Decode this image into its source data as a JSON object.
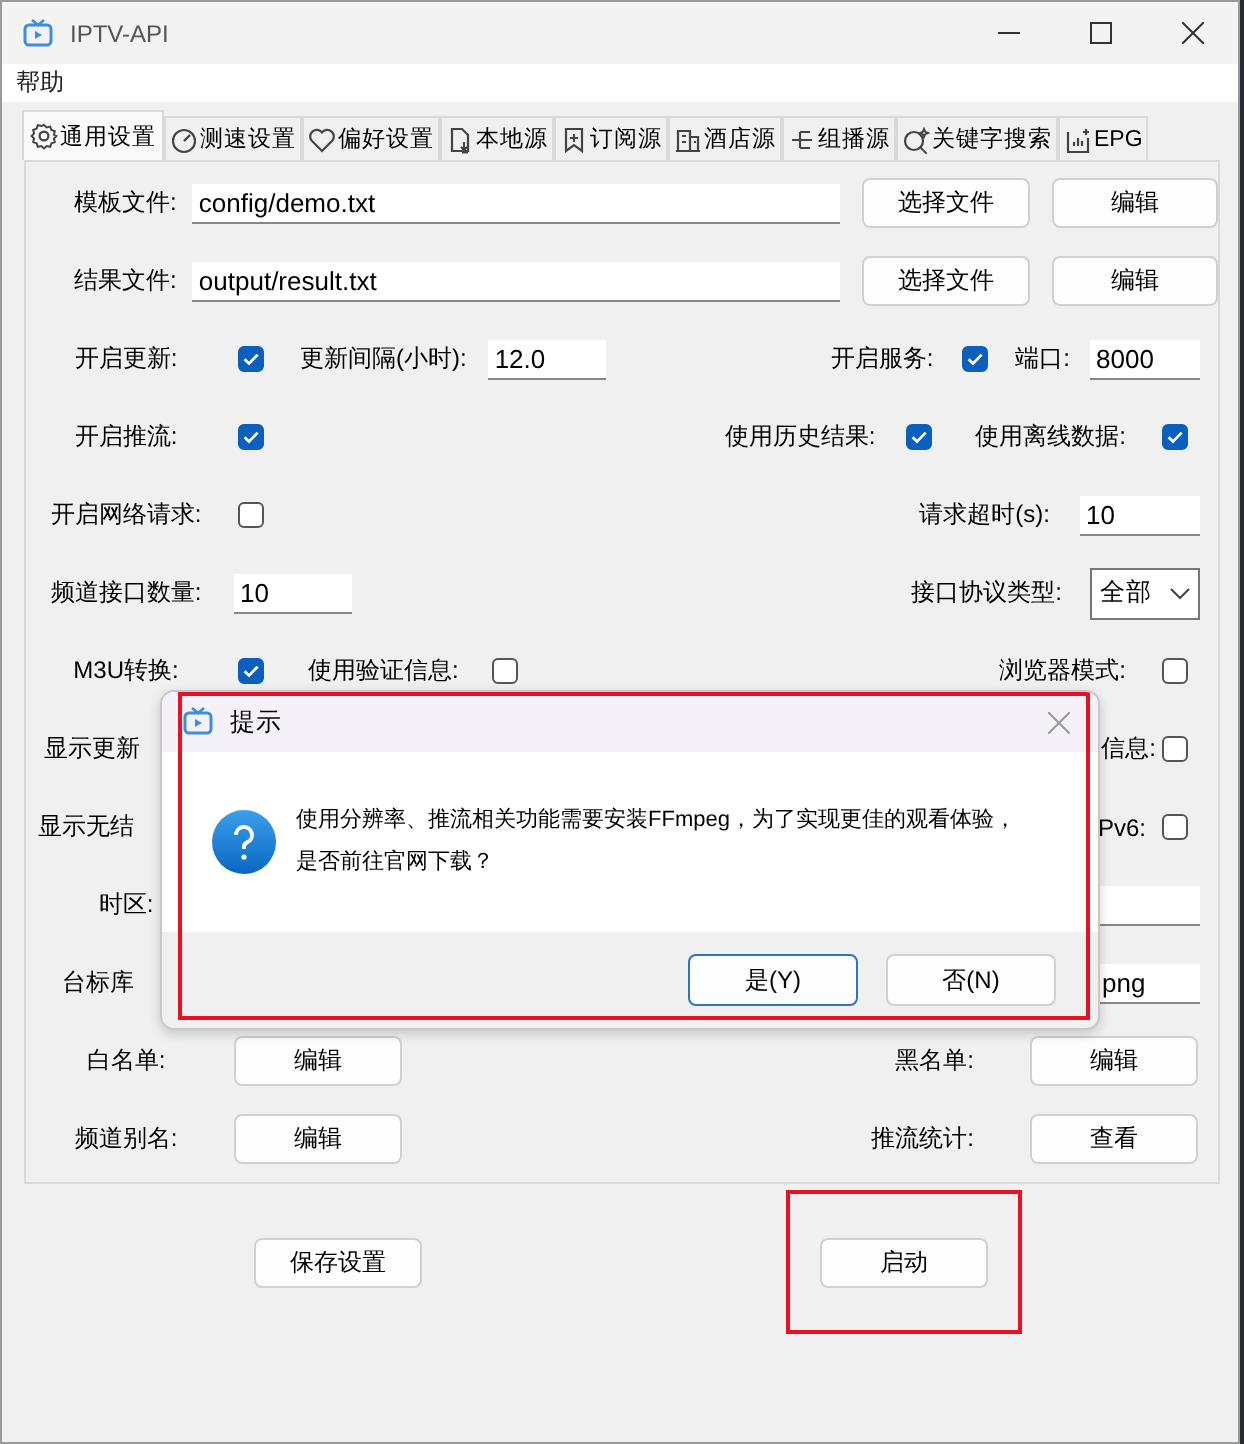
{
  "window": {
    "title": "IPTV-API"
  },
  "menu": [
    "帮助"
  ],
  "tabs": [
    {
      "label": "通用设置",
      "selected": true
    },
    {
      "label": "测速设置",
      "selected": false
    },
    {
      "label": "偏好设置",
      "selected": false
    },
    {
      "label": "本地源",
      "selected": false
    },
    {
      "label": "订阅源",
      "selected": false
    },
    {
      "label": "酒店源",
      "selected": false
    },
    {
      "label": "组播源",
      "selected": false
    },
    {
      "label": "关键字搜索",
      "selected": false
    },
    {
      "label": "EPG",
      "selected": false
    }
  ],
  "general": {
    "template_file": {
      "label": "模板文件:",
      "value": "config/demo.txt",
      "choose": "选择文件",
      "edit": "编辑"
    },
    "result_file": {
      "label": "结果文件:",
      "value": "output/result.txt",
      "choose": "选择文件",
      "edit": "编辑"
    },
    "open_update": {
      "label": "开启更新:",
      "checked": true
    },
    "update_interval": {
      "label": "更新间隔(小时):",
      "value": "12.0"
    },
    "open_service": {
      "label": "开启服务:",
      "checked": true
    },
    "port": {
      "label": "端口:",
      "value": "8000"
    },
    "open_rtmp": {
      "label": "开启推流:",
      "checked": true
    },
    "use_history": {
      "label": "使用历史结果:",
      "checked": true
    },
    "use_offline": {
      "label": "使用离线数据:",
      "checked": true
    },
    "open_request": {
      "label": "开启网络请求:",
      "checked": false
    },
    "request_timeout": {
      "label": "请求超时(s):",
      "value": "10"
    },
    "urls_limit": {
      "label": "频道接口数量:",
      "value": "10"
    },
    "ipv_type": {
      "label": "接口协议类型:",
      "value": "全部"
    },
    "m3u": {
      "label": "M3U转换:",
      "checked": true
    },
    "auth": {
      "label": "使用验证信息:",
      "checked": false
    },
    "browser": {
      "label": "浏览器模式:",
      "checked": false
    },
    "show_update_label": "显示更新",
    "info": {
      "label": "信息:",
      "checked": false
    },
    "show_noresult_label": "显示无结",
    "ipv6": {
      "label": "Pv6:",
      "checked": false
    },
    "timezone_label": "时区:",
    "logo_label": "台标库",
    "logo_value": "png",
    "whitelist": {
      "label": "白名单:",
      "button": "编辑"
    },
    "blacklist": {
      "label": "黑名单:",
      "button": "编辑"
    },
    "alias": {
      "label": "频道别名:",
      "button": "编辑"
    },
    "rtmp_stat": {
      "label": "推流统计:",
      "button": "查看"
    }
  },
  "save_button": {
    "label": "保存设置"
  },
  "start_button": {
    "label": "启动",
    "highlighted": true
  },
  "dialog": {
    "title": "提示",
    "message": "使用分辨率、推流相关功能需要安装FFmpeg，为了实现更佳的观看体验，",
    "message_line_2": "是否前往官网下载？",
    "buttons": [
      {
        "label": "是(Y)",
        "selected": true
      },
      {
        "label": "否(N)",
        "selected": false
      }
    ],
    "highlighted": true
  }
}
